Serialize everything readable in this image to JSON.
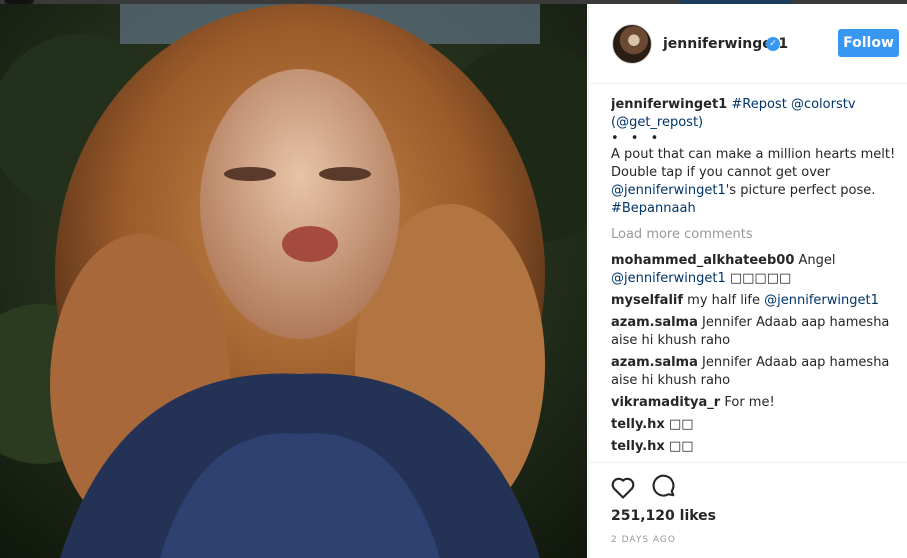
{
  "post": {
    "username": "jenniferwinget1",
    "follow_label": "Follow",
    "caption": {
      "user": "jenniferwinget1",
      "tag_repost": "#Repost",
      "mention_colorstv": "@colorstv",
      "get_repost": "(@get_repost)",
      "dots": "• • •",
      "text1": "A pout that can make a million hearts melt! Double tap if you cannot get over ",
      "mention_self": "@jenniferwinget1",
      "text2": "'s picture perfect pose. ",
      "hashtag": "#Bepannaah"
    },
    "load_more": "Load more comments",
    "likes": "251,120 likes",
    "time": "2 DAYS AGO"
  },
  "comments": [
    {
      "user": "mohammed_alkhateeb00",
      "text": "Angel ",
      "mention": "@jenniferwinget1",
      "after": " □□□□□"
    },
    {
      "user": "myselfalif",
      "text": "my half life ",
      "mention": "@jenniferwinget1",
      "after": ""
    },
    {
      "user": "azam.salma",
      "text": "Jennifer Adaab aap hamesha aise hi khush raho",
      "mention": "",
      "after": ""
    },
    {
      "user": "azam.salma",
      "text": "Jennifer Adaab aap hamesha aise hi khush raho",
      "mention": "",
      "after": ""
    },
    {
      "user": "vikramaditya_r",
      "text": "For me!",
      "mention": "",
      "after": ""
    },
    {
      "user": "telly.hx",
      "text": "□□",
      "mention": "",
      "after": ""
    },
    {
      "user": "telly.hx",
      "text": "□□",
      "mention": "",
      "after": ""
    }
  ],
  "colors": {
    "accent": "#3897f0",
    "link": "#003569",
    "muted": "#999999"
  },
  "icons": [
    "heart-icon",
    "comment-bubble-icon",
    "verified-badge-icon"
  ]
}
